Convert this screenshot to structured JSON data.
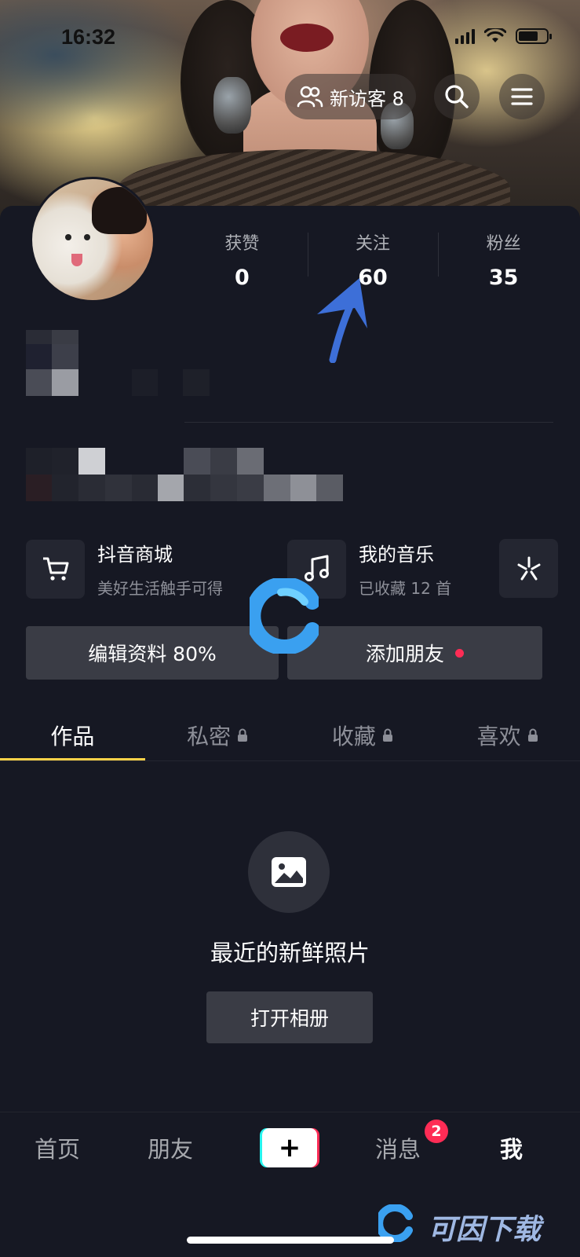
{
  "status_bar": {
    "time": "16:32"
  },
  "header": {
    "visitor_label": "新访客 8",
    "search_icon": "search-icon",
    "menu_icon": "menu-icon"
  },
  "stats": [
    {
      "label": "获赞",
      "value": "0"
    },
    {
      "label": "关注",
      "value": "60"
    },
    {
      "label": "粉丝",
      "value": "35"
    }
  ],
  "features": {
    "shop": {
      "title": "抖音商城",
      "subtitle": "美好生活触手可得",
      "icon": "cart-icon"
    },
    "music": {
      "title": "我的音乐",
      "subtitle": "已收藏 12 首",
      "icon": "music-note-icon"
    },
    "more_icon": "sparkle-icon"
  },
  "actions": {
    "edit_profile": "编辑资料 80%",
    "add_friends": "添加朋友"
  },
  "tabs": [
    {
      "label": "作品",
      "locked": false
    },
    {
      "label": "私密",
      "locked": true
    },
    {
      "label": "收藏",
      "locked": true
    },
    {
      "label": "喜欢",
      "locked": true
    }
  ],
  "empty_state": {
    "title": "最近的新鲜照片",
    "button": "打开相册"
  },
  "bottom_nav": {
    "home": "首页",
    "friends": "朋友",
    "create": "+",
    "messages": "消息",
    "messages_badge": "2",
    "me": "我"
  },
  "watermark": {
    "text": "可因下载"
  },
  "colors": {
    "background": "#161823",
    "accent_yellow": "#fbd249",
    "badge_red": "#fe2c55",
    "arrow_blue": "#3d6fd8"
  }
}
